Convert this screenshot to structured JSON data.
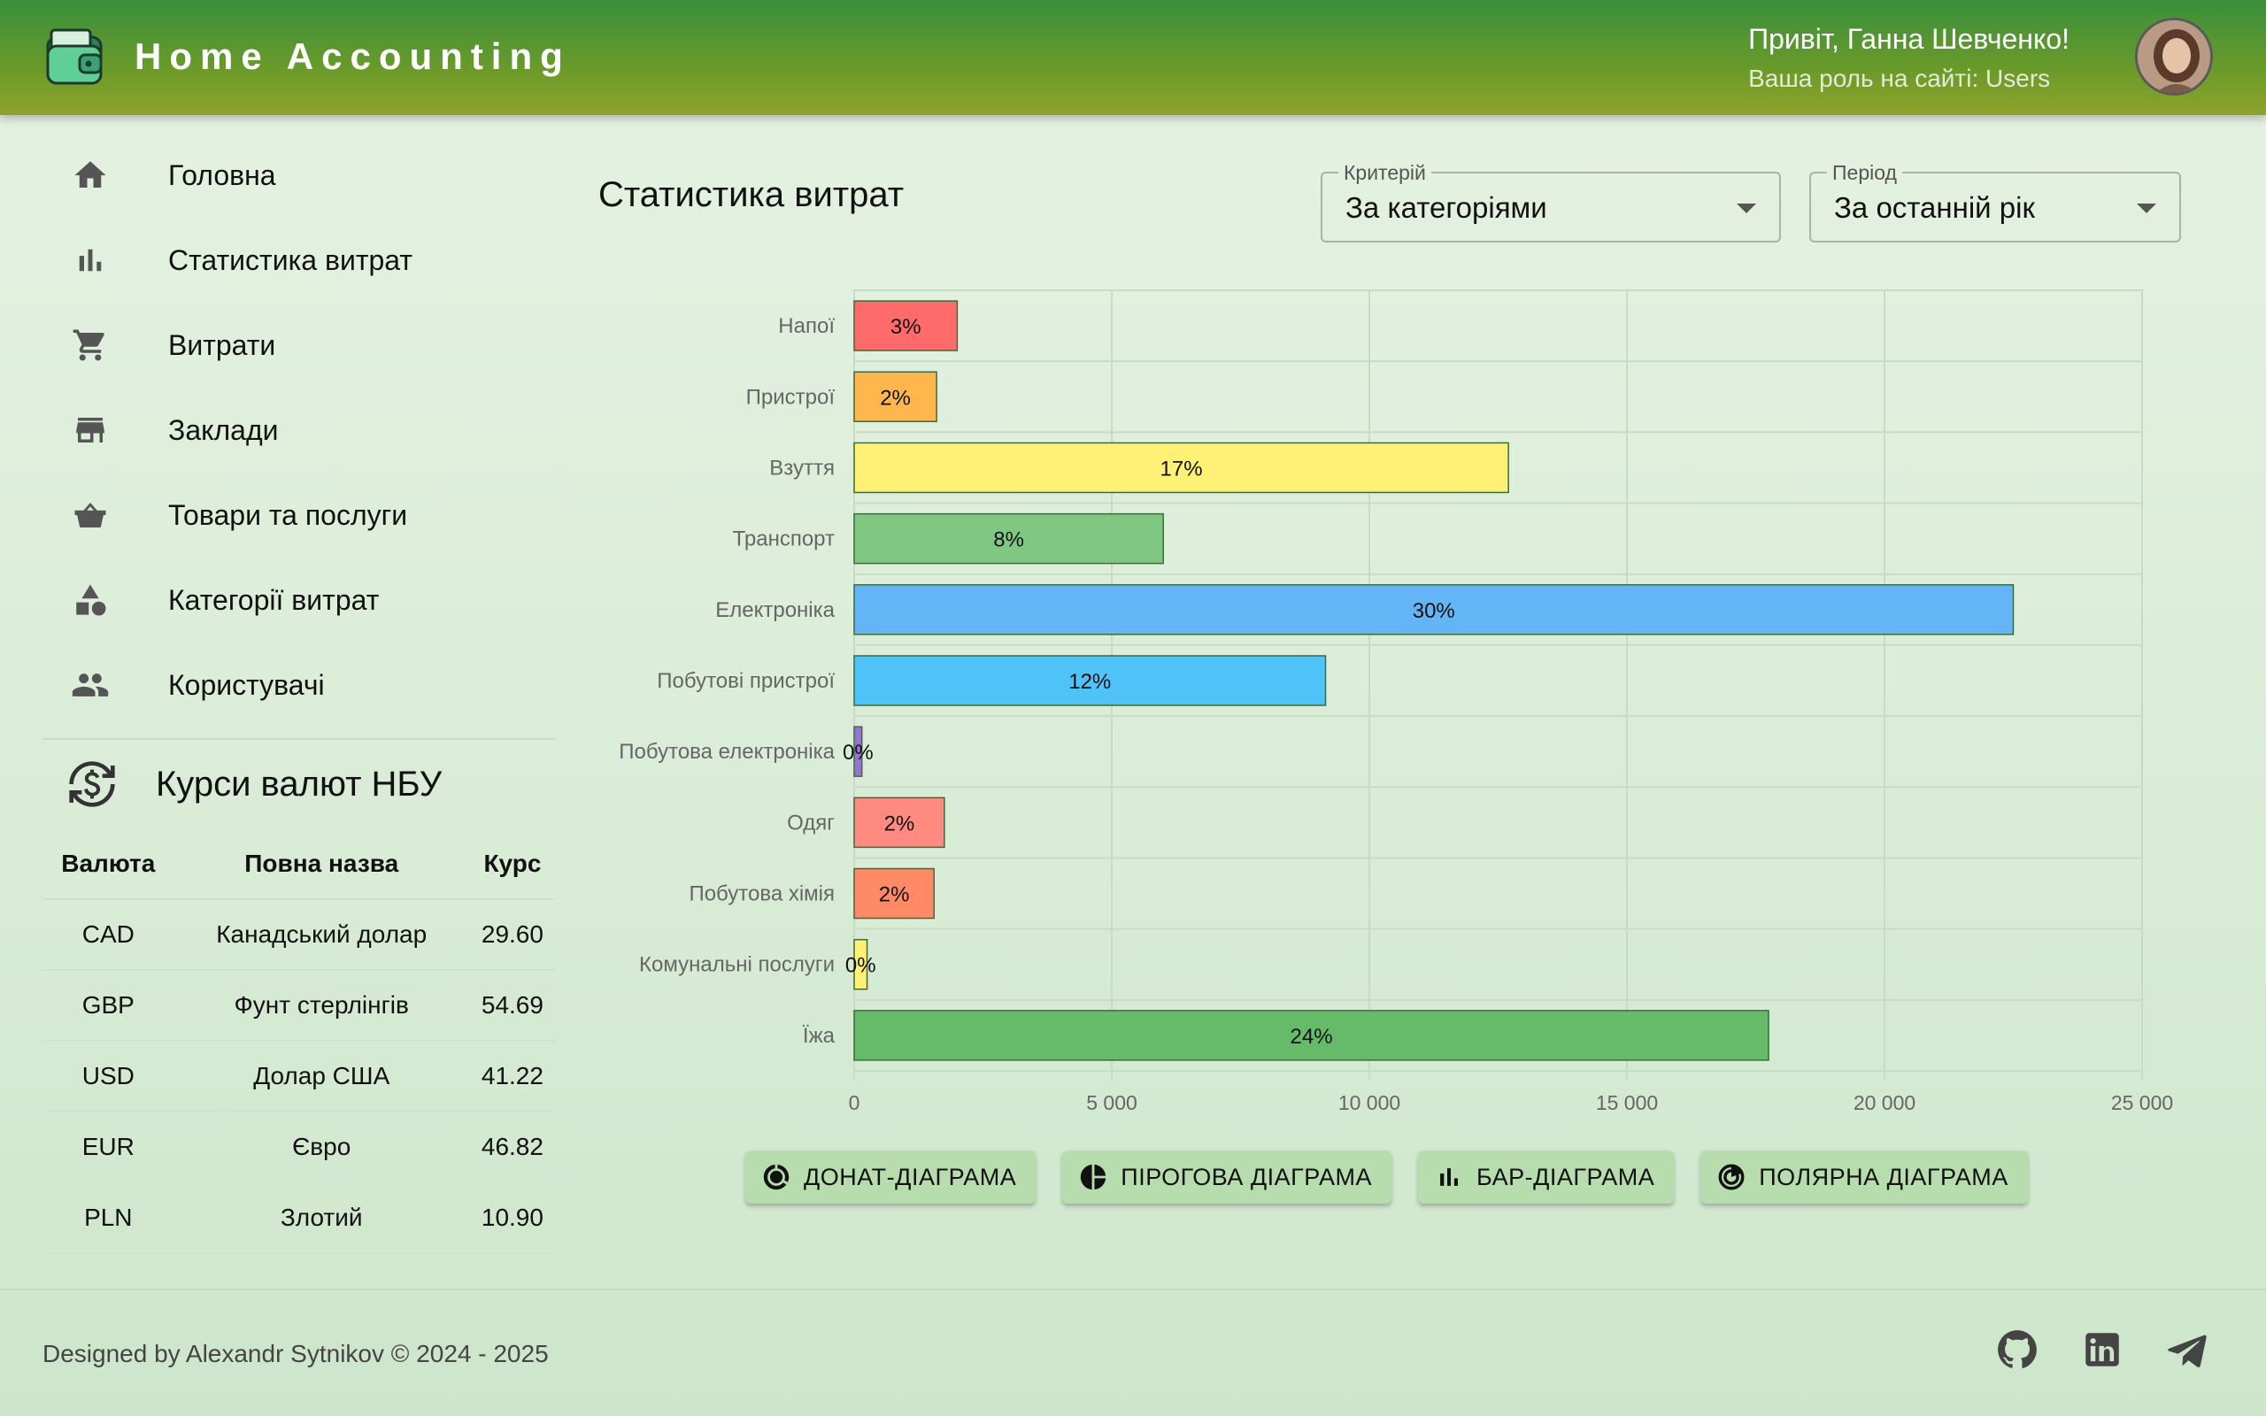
{
  "header": {
    "app_title": "Home Accounting",
    "greeting": "Привіт, Ганна Шевченко!",
    "role": "Ваша роль на сайті: Users"
  },
  "sidebar": {
    "items": [
      {
        "label": "Головна",
        "icon": "home-icon"
      },
      {
        "label": "Статистика витрат",
        "icon": "bar-chart-icon"
      },
      {
        "label": "Витрати",
        "icon": "cart-icon"
      },
      {
        "label": "Заклади",
        "icon": "store-icon"
      },
      {
        "label": "Товари та послуги",
        "icon": "basket-icon"
      },
      {
        "label": "Категорії витрат",
        "icon": "category-icon"
      },
      {
        "label": "Користувачі",
        "icon": "people-icon"
      }
    ]
  },
  "rates": {
    "title": "Курси валют НБУ",
    "headers": [
      "Валюта",
      "Повна назва",
      "Курс"
    ],
    "rows": [
      [
        "CAD",
        "Канадський долар",
        "29.60"
      ],
      [
        "GBP",
        "Фунт стерлінгів",
        "54.69"
      ],
      [
        "USD",
        "Долар США",
        "41.22"
      ],
      [
        "EUR",
        "Євро",
        "46.82"
      ],
      [
        "PLN",
        "Злотий",
        "10.90"
      ]
    ]
  },
  "main": {
    "title": "Статистика витрат",
    "criterion": {
      "legend": "Критерій",
      "value": "За категоріями"
    },
    "period": {
      "legend": "Період",
      "value": "За останній рік"
    }
  },
  "chart_data": {
    "type": "bar",
    "orientation": "horizontal",
    "categories": [
      "Напої",
      "Пристрої",
      "Взуття",
      "Транспорт",
      "Електроніка",
      "Побутові пристрої",
      "Побутова електроніка",
      "Одяг",
      "Побутова хімія",
      "Комунальні послуги",
      "Їжа"
    ],
    "values": [
      2000,
      1600,
      12700,
      6000,
      22500,
      9150,
      150,
      1750,
      1550,
      250,
      17750
    ],
    "labels": [
      "3%",
      "2%",
      "17%",
      "8%",
      "30%",
      "12%",
      "0%",
      "2%",
      "2%",
      "0%",
      "24%"
    ],
    "colors": [
      "#ff6b6b",
      "#ffb74d",
      "#fff176",
      "#81c784",
      "#64b5f6",
      "#4fc3f7",
      "#9575cd",
      "#ff8a80",
      "#ff8a65",
      "#fff176",
      "#66bb6a"
    ],
    "xlim": [
      0,
      25000
    ],
    "xticks": [
      "0",
      "5 000",
      "10 000",
      "15 000",
      "20 000",
      "25 000"
    ],
    "xtick_values": [
      0,
      5000,
      10000,
      15000,
      20000,
      25000
    ],
    "grid": true
  },
  "buttons": [
    {
      "label": "ДОНАТ-ДІАГРАМА",
      "icon": "donut-chart-icon"
    },
    {
      "label": "ПІРОГОВА ДІАГРАМА",
      "icon": "pie-chart-icon"
    },
    {
      "label": "БАР-ДІАГРАМА",
      "icon": "bar-chart-icon"
    },
    {
      "label": "ПОЛЯРНА ДІАГРАМА",
      "icon": "polar-chart-icon"
    }
  ],
  "footer": {
    "text": "Designed by Alexandr Sytnikov © 2024 - 2025"
  },
  "colors": {
    "header_start": "#3a8f3c",
    "header_end": "#8fa22a",
    "button_bg": "#b7dcae"
  }
}
